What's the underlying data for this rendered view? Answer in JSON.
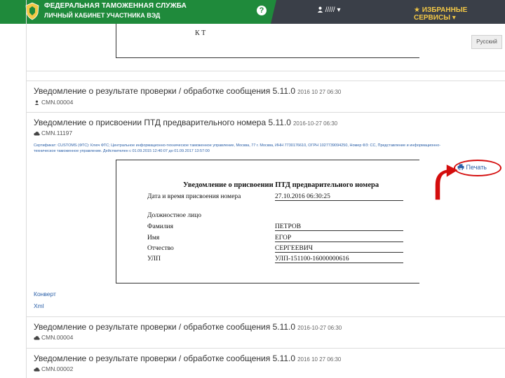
{
  "header": {
    "brand_line1": "ФЕДЕРАЛЬНАЯ ТАМОЖЕННАЯ СЛУЖБА",
    "brand_line2": "ЛИЧНЫЙ КАБИНЕТ УЧАСТНИКА ВЭД",
    "help_label": "?",
    "user_label": "/////",
    "favorites_label": "ИЗБРАННЫЕ СЕРВИСЫ",
    "colors": {
      "green": "#1f8a3b",
      "dark": "#3a3f48",
      "star": "#f3c846"
    }
  },
  "top_document": {
    "text": "К Т"
  },
  "language_button": "Русский",
  "messages": [
    {
      "title": "Уведомление о результате проверки / обработке сообщения 5.11.0",
      "timestamp": "2016 10 27 06:30",
      "code": "CMN.00004",
      "icon": "user-icon"
    },
    {
      "title": "Уведомление о присвоении ПТД предварительного номера 5.11.0",
      "timestamp": "2016-10-27 06:30",
      "code": "CMN.11197",
      "icon": "cloud-icon",
      "certificate_line1": "Сертификат: CUSTOMS (ФТС): Ключ ФТС; Центральное информационно-техническое таможенное управление, Москва, 77 г. Москва, ИНН 7730176610, ОГРН 1027739094250, Номер ФЗ: СС, Представление и информационно-",
      "certificate_line2": "техническое таможенное управление. Действителен с 01.09.2015 12:40:07 до 01.09.2017 13:57:00"
    },
    {
      "title": "Уведомление о результате проверки / обработке сообщения 5.11.0",
      "timestamp": "2016-10-27 06:30",
      "code": "CMN.00004",
      "icon": "cloud-icon"
    },
    {
      "title": "Уведомление о результате проверки / обработке сообщения 5.11.0",
      "timestamp": "2016 10 27 06:30",
      "code": "CMN.00002",
      "icon": "cloud-icon"
    }
  ],
  "document": {
    "title": "Уведомление о присвоении ПТД предварительного номера",
    "rows": [
      {
        "label": "Дата и время присвоения номера",
        "value": "27.10.2016 06:30:25"
      },
      {
        "label": "Должностное лицо",
        "value": ""
      },
      {
        "label": "Фамилия",
        "value": "ПЕТРОВ"
      },
      {
        "label": "Имя",
        "value": "ЕГОР"
      },
      {
        "label": "Отчество",
        "value": "СЕРГЕЕВИЧ"
      },
      {
        "label": "УЛП",
        "value": "УЛП-151100-16000000616"
      }
    ]
  },
  "print_label": "Печать",
  "links": {
    "envelope": "Конверт",
    "xml": "Xml"
  },
  "accent": {
    "arrow_red": "#d40d0d",
    "link_blue": "#2b60a8"
  }
}
